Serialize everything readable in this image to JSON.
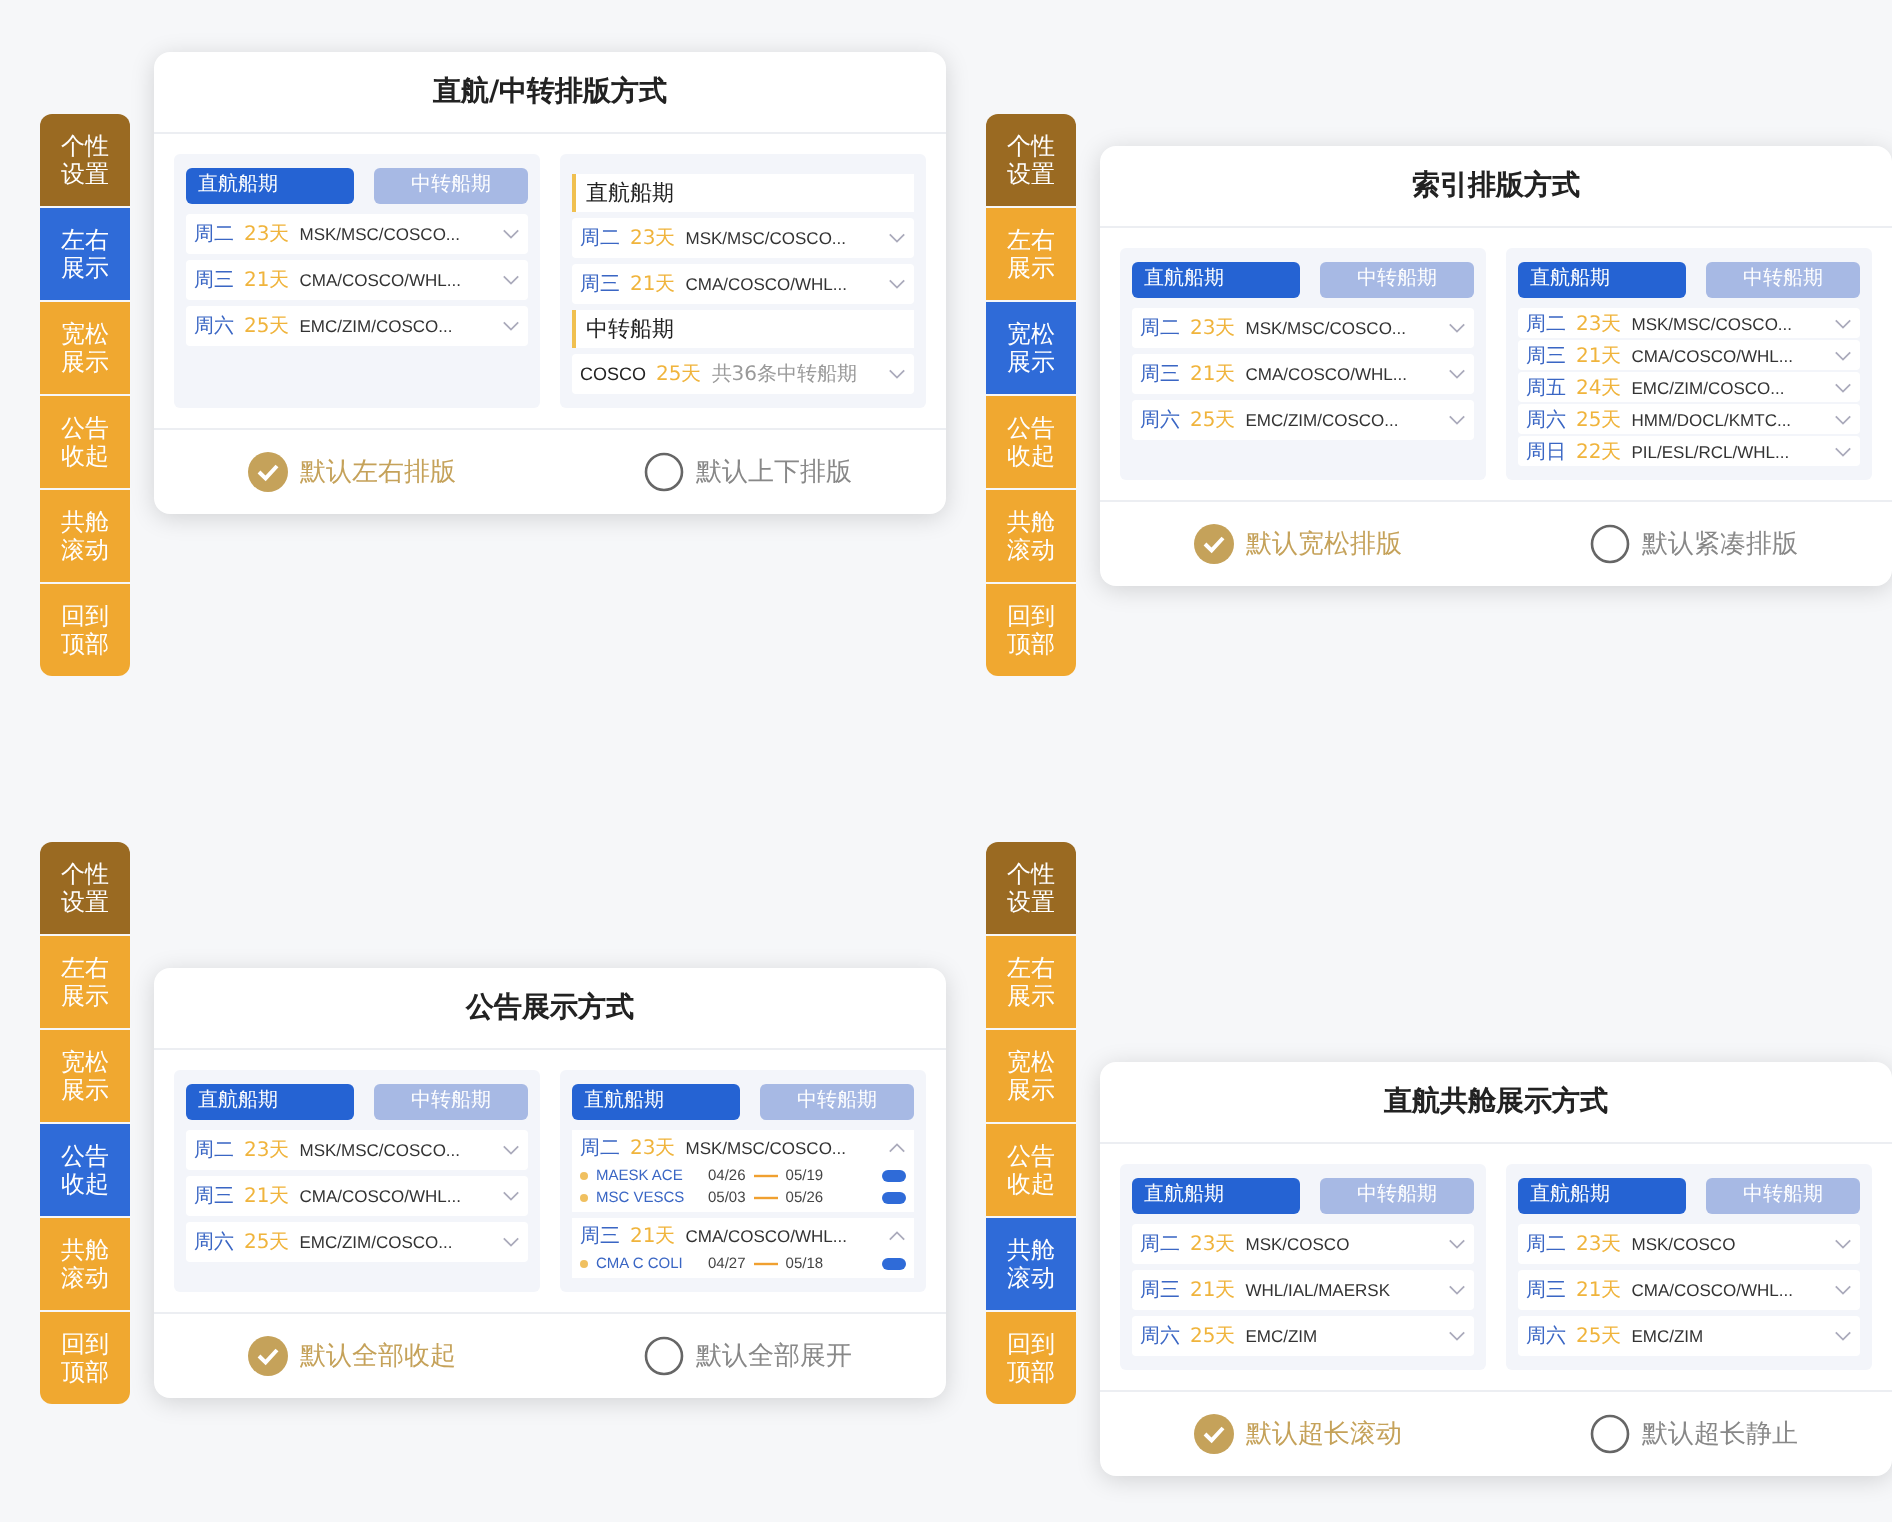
{
  "panels": [
    {
      "sidebar": {
        "header": "个性设置",
        "items": [
          {
            "label": "左右展示",
            "selected": true
          },
          {
            "label": "宽松展示",
            "selected": false
          },
          {
            "label": "公告收起",
            "selected": false
          },
          {
            "label": "共舱滚动",
            "selected": false
          },
          {
            "label": "回到顶部",
            "selected": false
          }
        ]
      },
      "title": "直航/中转排版方式",
      "previews": [
        {
          "kind": "standard",
          "tabs": [
            {
              "label": "直航船期",
              "selected": true
            },
            {
              "label": "中转船期",
              "selected": false
            }
          ],
          "rows": [
            {
              "day": "周二",
              "days": "23天",
              "carriers": "MSK/MSC/COSCO..."
            },
            {
              "day": "周三",
              "days": "21天",
              "carriers": "CMA/COSCO/WHL..."
            },
            {
              "day": "周六",
              "days": "25天",
              "carriers": "EMC/ZIM/COSCO..."
            }
          ]
        },
        {
          "kind": "sections",
          "sections": [
            {
              "heading": "直航船期",
              "rows": [
                {
                  "kind": "direct",
                  "day": "周二",
                  "days": "23天",
                  "carriers": "MSK/MSC/COSCO..."
                },
                {
                  "kind": "direct",
                  "day": "周三",
                  "days": "21天",
                  "carriers": "CMA/COSCO/WHL..."
                }
              ]
            },
            {
              "heading": "中转船期",
              "rows": [
                {
                  "kind": "transit",
                  "day": "COSCO",
                  "days": "25天",
                  "carriers": "共36条中转船期"
                }
              ]
            }
          ]
        }
      ],
      "options": [
        {
          "label": "默认左右排版",
          "selected": true
        },
        {
          "label": "默认上下排版",
          "selected": false
        }
      ]
    },
    {
      "sidebar": {
        "header": "个性设置",
        "items": [
          {
            "label": "左右展示",
            "selected": false
          },
          {
            "label": "宽松展示",
            "selected": true
          },
          {
            "label": "公告收起",
            "selected": false
          },
          {
            "label": "共舱滚动",
            "selected": false
          },
          {
            "label": "回到顶部",
            "selected": false
          }
        ]
      },
      "title": "索引排版方式",
      "previews": [
        {
          "kind": "standard",
          "tabs": [
            {
              "label": "直航船期",
              "selected": true
            },
            {
              "label": "中转船期",
              "selected": false
            }
          ],
          "rows": [
            {
              "day": "周二",
              "days": "23天",
              "carriers": "MSK/MSC/COSCO..."
            },
            {
              "day": "周三",
              "days": "21天",
              "carriers": "CMA/COSCO/WHL..."
            },
            {
              "day": "周六",
              "days": "25天",
              "carriers": "EMC/ZIM/COSCO..."
            }
          ]
        },
        {
          "kind": "compact",
          "tabs": [
            {
              "label": "直航船期",
              "selected": true
            },
            {
              "label": "中转船期",
              "selected": false
            }
          ],
          "rows": [
            {
              "day": "周二",
              "days": "23天",
              "carriers": "MSK/MSC/COSCO..."
            },
            {
              "day": "周三",
              "days": "21天",
              "carriers": "CMA/COSCO/WHL..."
            },
            {
              "day": "周五",
              "days": "24天",
              "carriers": "EMC/ZIM/COSCO..."
            },
            {
              "day": "周六",
              "days": "25天",
              "carriers": "HMM/DOCL/KMTC..."
            },
            {
              "day": "周日",
              "days": "22天",
              "carriers": "PIL/ESL/RCL/WHL..."
            }
          ]
        }
      ],
      "options": [
        {
          "label": "默认宽松排版",
          "selected": true
        },
        {
          "label": "默认紧凑排版",
          "selected": false
        }
      ]
    },
    {
      "sidebar": {
        "header": "个性设置",
        "items": [
          {
            "label": "左右展示",
            "selected": false
          },
          {
            "label": "宽松展示",
            "selected": false
          },
          {
            "label": "公告收起",
            "selected": true
          },
          {
            "label": "共舱滚动",
            "selected": false
          },
          {
            "label": "回到顶部",
            "selected": false
          }
        ]
      },
      "title": "公告展示方式",
      "previews": [
        {
          "kind": "standard",
          "tabs": [
            {
              "label": "直航船期",
              "selected": true
            },
            {
              "label": "中转船期",
              "selected": false
            }
          ],
          "rows": [
            {
              "day": "周二",
              "days": "23天",
              "carriers": "MSK/MSC/COSCO..."
            },
            {
              "day": "周三",
              "days": "21天",
              "carriers": "CMA/COSCO/WHL..."
            },
            {
              "day": "周六",
              "days": "25天",
              "carriers": "EMC/ZIM/COSCO..."
            }
          ]
        },
        {
          "kind": "expanded",
          "tabs": [
            {
              "label": "直航船期",
              "selected": true
            },
            {
              "label": "中转船期",
              "selected": false
            }
          ],
          "groups": [
            {
              "day": "周二",
              "days": "23天",
              "carriers": "MSK/MSC/COSCO...",
              "expanded": true,
              "vessels": [
                {
                  "name": "MAESK ACE",
                  "departure": "04/26",
                  "arrival": "05/19"
                },
                {
                  "name": "MSC VESCS",
                  "departure": "05/03",
                  "arrival": "05/26"
                }
              ]
            },
            {
              "day": "周三",
              "days": "21天",
              "carriers": "CMA/COSCO/WHL...",
              "expanded": true,
              "vessels": [
                {
                  "name": "CMA C COLI",
                  "departure": "04/27",
                  "arrival": "05/18"
                }
              ]
            }
          ]
        }
      ],
      "options": [
        {
          "label": "默认全部收起",
          "selected": true
        },
        {
          "label": "默认全部展开",
          "selected": false
        }
      ]
    },
    {
      "sidebar": {
        "header": "个性设置",
        "items": [
          {
            "label": "左右展示",
            "selected": false
          },
          {
            "label": "宽松展示",
            "selected": false
          },
          {
            "label": "公告收起",
            "selected": false
          },
          {
            "label": "共舱滚动",
            "selected": true
          },
          {
            "label": "回到顶部",
            "selected": false
          }
        ]
      },
      "title": "直航共舱展示方式",
      "previews": [
        {
          "kind": "standard",
          "tabs": [
            {
              "label": "直航船期",
              "selected": true
            },
            {
              "label": "中转船期",
              "selected": false
            }
          ],
          "rows": [
            {
              "day": "周二",
              "days": "23天",
              "carriers": "MSK/COSCO"
            },
            {
              "day": "周三",
              "days": "21天",
              "carriers": "WHL/IAL/MAERSK"
            },
            {
              "day": "周六",
              "days": "25天",
              "carriers": "EMC/ZIM"
            }
          ]
        },
        {
          "kind": "standard",
          "tabs": [
            {
              "label": "直航船期",
              "selected": true
            },
            {
              "label": "中转船期",
              "selected": false
            }
          ],
          "rows": [
            {
              "day": "周二",
              "days": "23天",
              "carriers": "MSK/COSCO"
            },
            {
              "day": "周三",
              "days": "21天",
              "carriers": "CMA/COSCO/WHL..."
            },
            {
              "day": "周六",
              "days": "25天",
              "carriers": "EMC/ZIM"
            }
          ]
        }
      ],
      "options": [
        {
          "label": "默认超长滚动",
          "selected": true
        },
        {
          "label": "默认超长静止",
          "selected": false
        }
      ]
    }
  ]
}
